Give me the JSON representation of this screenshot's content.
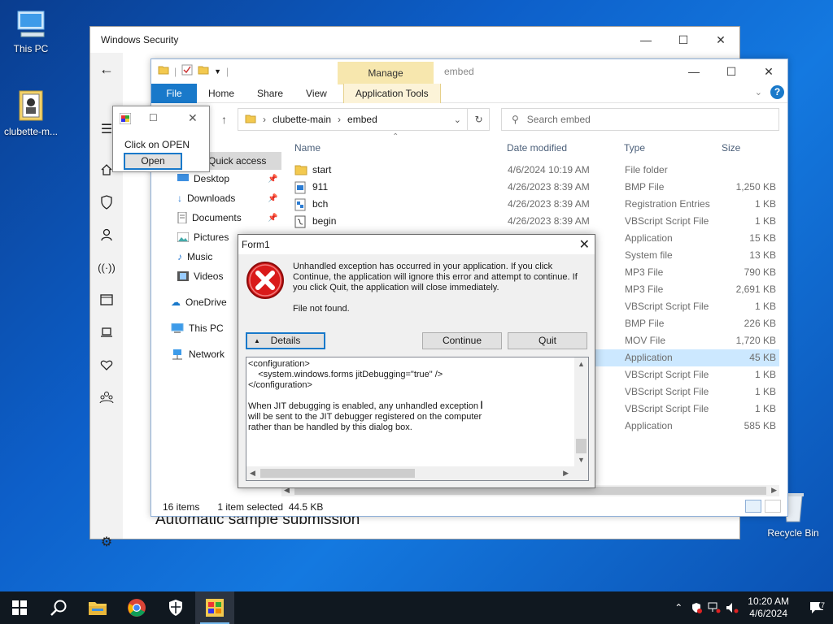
{
  "desktop": {
    "icons": [
      {
        "label": "This PC"
      },
      {
        "label": "clubette-m..."
      },
      {
        "label": "Recycle Bin"
      }
    ]
  },
  "security_window": {
    "title": "Windows Security",
    "heading": "Automatic sample submission"
  },
  "explorer": {
    "title": "embed",
    "manage_tab": "Manage",
    "ribbon_tabs": [
      "File",
      "Home",
      "Share",
      "View",
      "Application Tools"
    ],
    "breadcrumb": [
      "clubette-main",
      "embed"
    ],
    "search_placeholder": "Search embed",
    "nav": {
      "quick_access": "Quick access",
      "items": [
        "Desktop",
        "Downloads",
        "Documents",
        "Pictures",
        "Music",
        "Videos",
        "OneDrive",
        "This PC",
        "Network"
      ]
    },
    "columns": [
      "Name",
      "Date modified",
      "Type",
      "Size"
    ],
    "files": [
      {
        "name": "start",
        "date": "4/6/2024 10:19 AM",
        "type": "File folder",
        "size": ""
      },
      {
        "name": "911",
        "date": "4/26/2023 8:39 AM",
        "type": "BMP File",
        "size": "1,250 KB"
      },
      {
        "name": "bch",
        "date": "4/26/2023 8:39 AM",
        "type": "Registration Entries",
        "size": "1 KB"
      },
      {
        "name": "begin",
        "date": "4/26/2023 8:39 AM",
        "type": "VBScript Script File",
        "size": "1 KB"
      },
      {
        "name": "",
        "date": "",
        "type": "Application",
        "size": "15 KB"
      },
      {
        "name": "",
        "date": "",
        "type": "System file",
        "size": "13 KB"
      },
      {
        "name": "",
        "date": "",
        "type": "MP3 File",
        "size": "790 KB"
      },
      {
        "name": "",
        "date": "",
        "type": "MP3 File",
        "size": "2,691 KB"
      },
      {
        "name": "",
        "date": "",
        "type": "VBScript Script File",
        "size": "1 KB"
      },
      {
        "name": "",
        "date": "",
        "type": "BMP File",
        "size": "226 KB"
      },
      {
        "name": "",
        "date": "",
        "type": "MOV File",
        "size": "1,720 KB"
      },
      {
        "name": "",
        "date": "",
        "type": "Application",
        "size": "45 KB"
      },
      {
        "name": "",
        "date": "",
        "type": "VBScript Script File",
        "size": "1 KB"
      },
      {
        "name": "",
        "date": "",
        "type": "VBScript Script File",
        "size": "1 KB"
      },
      {
        "name": "",
        "date": "",
        "type": "VBScript Script File",
        "size": "1 KB"
      },
      {
        "name": "",
        "date": "",
        "type": "Application",
        "size": "585 KB"
      }
    ],
    "selected_index": 11,
    "status": {
      "items": "16 items",
      "selected": "1 item selected  44.5 KB"
    }
  },
  "mini_window": {
    "text": "Click on OPEN",
    "button": "Open"
  },
  "form1": {
    "title": "Form1",
    "message": "Unhandled exception has occurred in your application. If you click Continue, the application will ignore this error and attempt to continue. If you click Quit, the application will close immediately.",
    "detail_line": "File not found.",
    "details_button": "Details",
    "continue_button": "Continue",
    "quit_button": "Quit",
    "details_text": "<configuration>\n    <system.windows.forms jitDebugging=\"true\" />\n</configuration>\n\nWhen JIT debugging is enabled, any unhandled exception\nwill be sent to the JIT debugger registered on the computer\nrather than be handled by this dialog box."
  },
  "taskbar": {
    "apps": [
      "start-icon",
      "search-icon",
      "file-explorer-icon",
      "chrome-icon",
      "windows-security-icon",
      "form-app-icon"
    ],
    "time": "10:20 AM",
    "date": "4/6/2024",
    "notification_count": "7"
  }
}
